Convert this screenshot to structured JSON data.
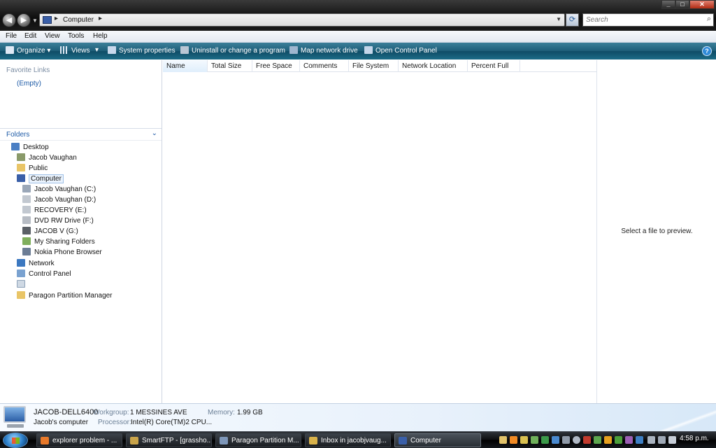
{
  "window": {
    "address_crumb": "Computer",
    "search_placeholder": "Search"
  },
  "menu": [
    "File",
    "Edit",
    "View",
    "Tools",
    "Help"
  ],
  "toolbar": {
    "organize": "Organize",
    "views": "Views",
    "system_properties": "System properties",
    "uninstall": "Uninstall or change a program",
    "map_drive": "Map network drive",
    "control_panel": "Open Control Panel"
  },
  "favorites": {
    "title": "Favorite Links",
    "empty": "(Empty)"
  },
  "folders": {
    "title": "Folders",
    "items": [
      {
        "label": "Desktop",
        "icon": "desktop-icon"
      },
      {
        "label": "Jacob Vaughan",
        "icon": "user-folder-icon"
      },
      {
        "label": "Public",
        "icon": "folder-icon"
      },
      {
        "label": "Computer",
        "icon": "computer-icon"
      },
      {
        "label": "Jacob Vaughan (C:)",
        "icon": "drive-icon"
      },
      {
        "label": "Jacob Vaughan (D:)",
        "icon": "drive-icon"
      },
      {
        "label": "RECOVERY (E:)",
        "icon": "drive-icon"
      },
      {
        "label": "DVD RW Drive (F:)",
        "icon": "dvd-drive-icon"
      },
      {
        "label": "JACOB V (G:)",
        "icon": "usb-drive-icon"
      },
      {
        "label": "My Sharing Folders",
        "icon": "sharing-folder-icon"
      },
      {
        "label": "Nokia Phone Browser",
        "icon": "phone-icon"
      },
      {
        "label": "Network",
        "icon": "network-icon"
      },
      {
        "label": "Control Panel",
        "icon": "control-panel-icon"
      },
      {
        "label": "",
        "icon": "recycle-bin-icon"
      },
      {
        "label": "Paragon Partition Manager",
        "icon": "folder-icon"
      }
    ]
  },
  "columns": [
    "Name",
    "Total Size",
    "Free Space",
    "Comments",
    "File System",
    "Network Location",
    "Percent Full"
  ],
  "preview": {
    "message": "Select a file to preview."
  },
  "details": {
    "computer_name": "JACOB-DELL6400",
    "description": "Jacob's computer",
    "workgroup_label": "Workgroup:",
    "workgroup_value": "1 MESSINES AVE",
    "memory_label": "Memory:",
    "memory_value": "1.99 GB",
    "processor_label": "Processor:",
    "processor_value": "Intel(R) Core(TM)2 CPU..."
  },
  "taskbar": {
    "tasks": [
      {
        "label": "explorer problem - ...",
        "icon": "firefox-icon"
      },
      {
        "label": "SmartFTP - [grassho...",
        "icon": "smartftp-icon"
      },
      {
        "label": "Paragon Partition M...",
        "icon": "paragon-icon"
      },
      {
        "label": "Inbox in jacobjvaug...",
        "icon": "mail-icon"
      },
      {
        "label": "Computer",
        "icon": "computer-icon"
      }
    ],
    "clock": "4:58 p.m."
  },
  "colors": {
    "command_bar": "#1f5f7a",
    "link_blue": "#1d5aa6",
    "taskbar": "#0b0c0e"
  }
}
